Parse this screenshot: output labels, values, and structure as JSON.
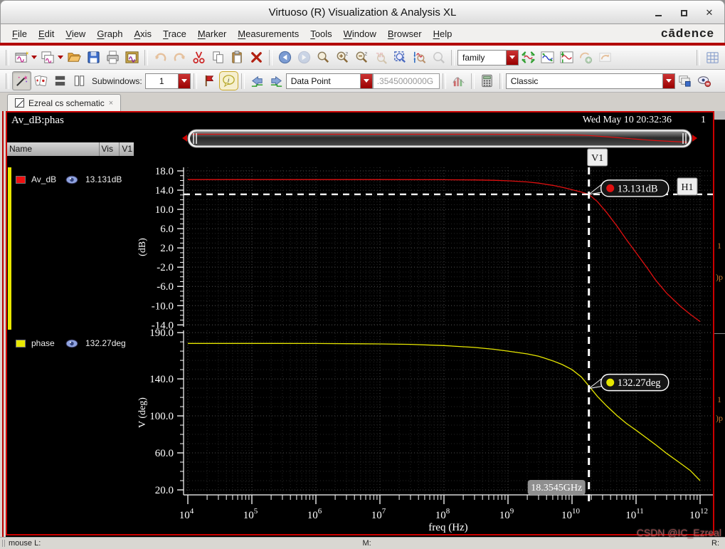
{
  "window": {
    "title": "Virtuoso (R) Visualization & Analysis XL"
  },
  "menu": {
    "items": [
      "File",
      "Edit",
      "View",
      "Graph",
      "Axis",
      "Trace",
      "Marker",
      "Measurements",
      "Tools",
      "Window",
      "Browser",
      "Help"
    ],
    "logo": "cādence"
  },
  "toolbar": {
    "family": "family",
    "subwindows_label": "Subwindows:",
    "subwindows_value": "1",
    "datapoint": "Data Point",
    "datapoint_value": ".3545000000G",
    "style": "Classic"
  },
  "tab": {
    "label": "Ezreal cs schematic",
    "close": "×"
  },
  "graph": {
    "title": "Av_dB:phas",
    "timestamp": "Wed May 10 20:32:36",
    "page": "1",
    "legend": {
      "columns": [
        "Name",
        "Vis",
        "V1"
      ],
      "rows": [
        {
          "name": "Av_dB",
          "color": "#ee1111",
          "value": "13.131dB"
        },
        {
          "name": "phase",
          "color": "#e8e800",
          "value": "132.27deg"
        }
      ]
    }
  },
  "sliver": {
    "fragments": [
      "1",
      ")p",
      "1",
      ")p"
    ]
  },
  "status": {
    "left": "mouse L:",
    "middle": "M:",
    "right": "R:"
  },
  "watermark": "CSDN @IC_Ezreal",
  "chart_data": {
    "type": "line",
    "title": "Av_dB:phas",
    "x_axis": {
      "label": "freq (Hz)",
      "scale": "log",
      "exp_min": 4,
      "exp_max": 12
    },
    "strips": [
      {
        "id": "gain",
        "ylabel": "(dB)",
        "ymin": -14.4,
        "ymax": 18.74,
        "major_ticks": [
          18,
          14,
          10,
          6,
          2,
          -2,
          -6,
          -10,
          -14
        ],
        "minor_step": 1,
        "series": {
          "name": "Av_dB",
          "color": "#e01010",
          "points": [
            [
              10000.0,
              16.2
            ],
            [
              100000.0,
              16.2
            ],
            [
              1000000.0,
              16.2
            ],
            [
              10000000.0,
              16.2
            ],
            [
              100000000.0,
              16.17
            ],
            [
              300000000.0,
              16.12
            ],
            [
              600000000.0,
              16.05
            ],
            [
              1000000000.0,
              15.95
            ],
            [
              2000000000.0,
              15.7
            ],
            [
              3000000000.0,
              15.45
            ],
            [
              5000000000.0,
              15.0
            ],
            [
              7000000000.0,
              14.6
            ],
            [
              10000000000.0,
              14.1
            ],
            [
              14000000000.0,
              13.6
            ],
            [
              18345000000.0,
              13.131
            ],
            [
              25000000000.0,
              11.6
            ],
            [
              35000000000.0,
              9.3
            ],
            [
              50000000000.0,
              6.6
            ],
            [
              70000000000.0,
              3.8
            ],
            [
              100000000000.0,
              1.0
            ],
            [
              150000000000.0,
              -2.2
            ],
            [
              200000000000.0,
              -4.6
            ],
            [
              300000000000.0,
              -7.4
            ],
            [
              500000000000.0,
              -10.2
            ],
            [
              700000000000.0,
              -11.8
            ],
            [
              1000000000000.0,
              -13.3
            ]
          ]
        }
      },
      {
        "id": "phase",
        "ylabel": "V (deg)",
        "ymin": 14.6,
        "ymax": 192.4,
        "major_ticks": [
          190,
          140,
          100,
          60,
          20
        ],
        "minor_step": 10,
        "series": {
          "name": "phase",
          "color": "#e6e600",
          "points": [
            [
              10000.0,
              178.3
            ],
            [
              100000.0,
              178.3
            ],
            [
              1000000.0,
              178.2
            ],
            [
              10000000.0,
              177.8
            ],
            [
              30000000.0,
              177.3
            ],
            [
              100000000.0,
              176.0
            ],
            [
              300000000.0,
              174.0
            ],
            [
              600000000.0,
              172.0
            ],
            [
              1000000000.0,
              170.0
            ],
            [
              2000000000.0,
              167.0
            ],
            [
              3000000000.0,
              164.5
            ],
            [
              5000000000.0,
              159.5
            ],
            [
              7000000000.0,
              155.5
            ],
            [
              10000000000.0,
              150.0
            ],
            [
              14000000000.0,
              142.0
            ],
            [
              18345000000.0,
              132.27
            ],
            [
              25000000000.0,
              121.0
            ],
            [
              35000000000.0,
              110.5
            ],
            [
              50000000000.0,
              100.5
            ],
            [
              70000000000.0,
              92.0
            ],
            [
              100000000000.0,
              84.5
            ],
            [
              150000000000.0,
              75.5
            ],
            [
              200000000000.0,
              69.0
            ],
            [
              300000000000.0,
              59.5
            ],
            [
              500000000000.0,
              48.5
            ],
            [
              700000000000.0,
              41.0
            ],
            [
              1000000000000.0,
              30.0
            ]
          ]
        }
      }
    ],
    "markers": {
      "v1": {
        "label": "V1",
        "freq": 18345000000.0,
        "freq_label": "18.3545GHz"
      },
      "h1": {
        "label": "H1",
        "gain_db": 13.131
      },
      "gain_point": {
        "label": "13.131dB",
        "color": "#e01010"
      },
      "phase_point": {
        "label": "132.27deg",
        "color": "#e6e600"
      }
    },
    "legend_position": "left",
    "grid": true
  }
}
